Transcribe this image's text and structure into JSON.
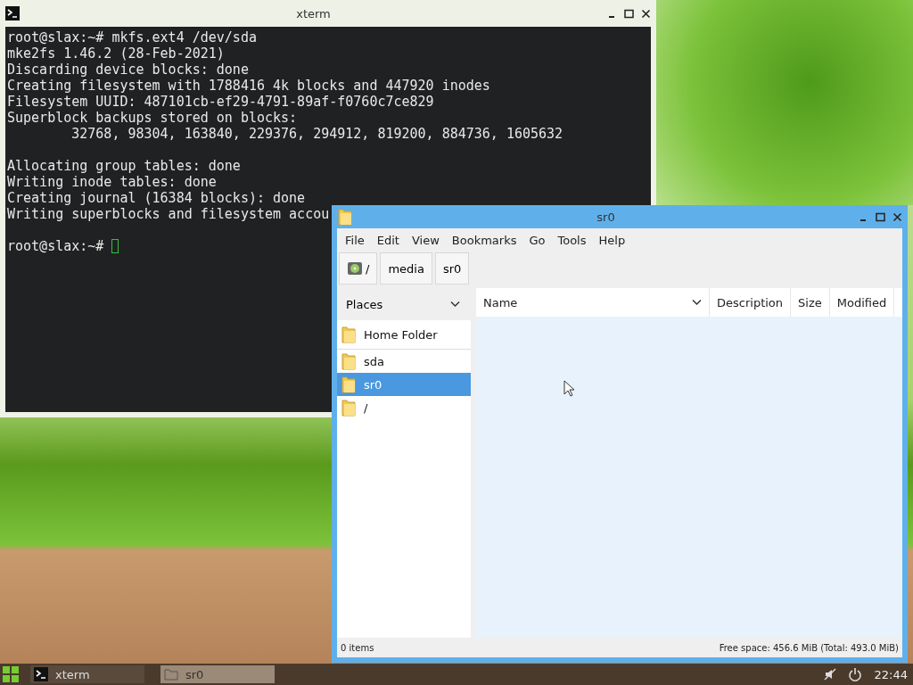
{
  "terminal": {
    "title": "xterm",
    "blocks": [
      [
        "root@slax:~# mkfs.ext4 /dev/sda",
        "mke2fs 1.46.2 (28-Feb-2021)",
        "Discarding device blocks: done",
        "Creating filesystem with 1788416 4k blocks and 447920 inodes",
        "Filesystem UUID: 487101cb-ef29-4791-89af-f0760c7ce829",
        "Superblock backups stored on blocks:",
        "        32768, 98304, 163840, 229376, 294912, 819200, 884736, 1605632"
      ],
      [
        "Allocating group tables: done",
        "Writing inode tables: done",
        "Creating journal (16384 blocks): done",
        "Writing superblocks and filesystem accou"
      ]
    ],
    "prompt": "root@slax:~#"
  },
  "file_manager": {
    "title": "sr0",
    "menu": [
      "File",
      "Edit",
      "View",
      "Bookmarks",
      "Go",
      "Tools",
      "Help"
    ],
    "path": [
      {
        "label": "/",
        "kind": "drive"
      },
      {
        "label": "media",
        "kind": "plain"
      },
      {
        "label": "sr0",
        "kind": "plain"
      }
    ],
    "places_title": "Places",
    "places": [
      {
        "label": "Home Folder",
        "selected": false
      },
      {
        "label": "sda",
        "selected": false
      },
      {
        "label": "sr0",
        "selected": true
      },
      {
        "label": "/",
        "selected": false
      }
    ],
    "columns": [
      "Name",
      "Description",
      "Size",
      "Modified"
    ],
    "status_left": "0 items",
    "status_right": "Free space: 456.6 MiB (Total: 493.0 MiB)"
  },
  "taskbar": {
    "tasks": [
      {
        "label": "xterm",
        "kind": "terminal",
        "selected": false
      },
      {
        "label": "sr0",
        "kind": "folder",
        "selected": true
      }
    ],
    "clock": "22:44"
  }
}
